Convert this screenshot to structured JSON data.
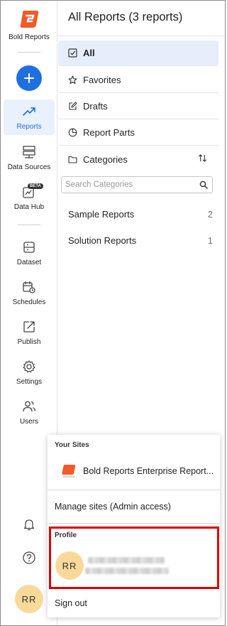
{
  "brand": {
    "name": "Bold Reports",
    "color": "#f15a29"
  },
  "rail": {
    "add_color": "#1f6fe0",
    "items": [
      {
        "label": "Reports",
        "icon": "trending-up-icon",
        "active": true
      },
      {
        "label": "Data Sources",
        "icon": "server-icon"
      },
      {
        "label": "Data Hub",
        "icon": "data-hub-icon",
        "badge": "BETA"
      },
      {
        "label": "Dataset",
        "icon": "dataset-icon"
      },
      {
        "label": "Schedules",
        "icon": "calendar-clock-icon"
      },
      {
        "label": "Publish",
        "icon": "publish-icon"
      },
      {
        "label": "Settings",
        "icon": "gear-icon"
      },
      {
        "label": "Users",
        "icon": "users-icon"
      }
    ],
    "bottom": {
      "notifications_icon": "bell-icon",
      "help_icon": "help-icon",
      "avatar_initials": "RR"
    }
  },
  "panel": {
    "title": "All Reports (3 reports)",
    "menu": [
      {
        "label": "All",
        "icon": "checkbox-icon",
        "active": true
      },
      {
        "label": "Favorites",
        "icon": "star-icon"
      },
      {
        "label": "Drafts",
        "icon": "edit-icon"
      },
      {
        "label": "Report Parts",
        "icon": "pie-chart-icon"
      },
      {
        "label": "Categories",
        "icon": "folder-icon"
      }
    ],
    "search_placeholder": "Search Categories",
    "categories": [
      {
        "name": "Sample Reports",
        "count": "2"
      },
      {
        "name": "Solution Reports",
        "count": "1"
      }
    ]
  },
  "popup": {
    "your_sites_label": "Your Sites",
    "site_name": "Bold Reports Enterprise Report...",
    "manage_label": "Manage sites (Admin access)",
    "profile_label": "Profile",
    "profile_initials": "RR",
    "sign_out_label": "Sign out"
  }
}
